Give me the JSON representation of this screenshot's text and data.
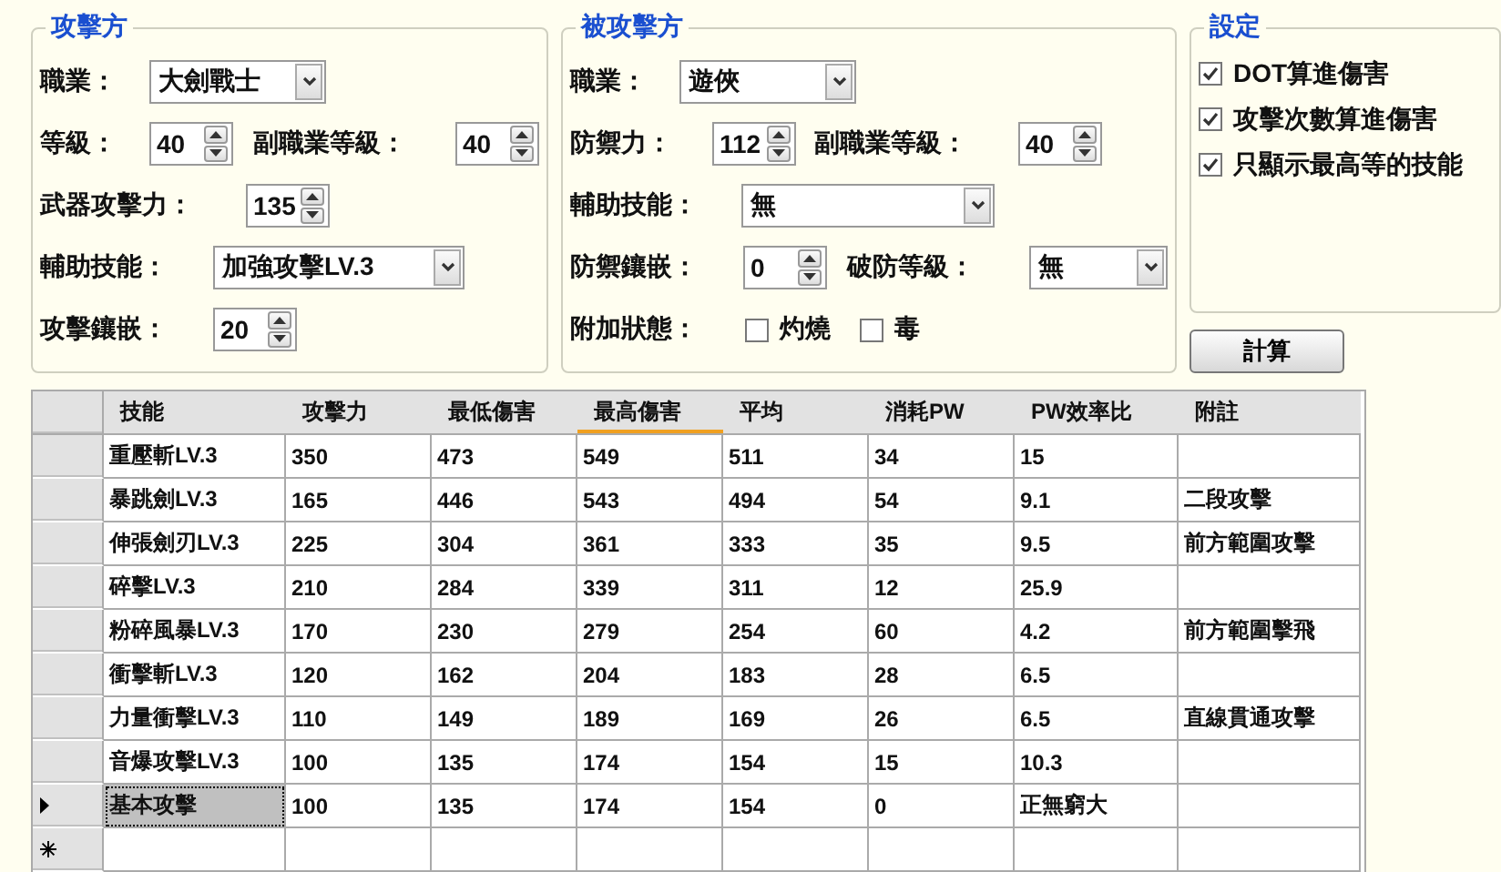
{
  "attacker": {
    "title": "攻擊方",
    "job": {
      "label": "職業：",
      "value": "大劍戰士"
    },
    "level": {
      "label": "等級：",
      "value": "40"
    },
    "sub_job_level": {
      "label": "副職業等級：",
      "value": "40"
    },
    "weapon_attack": {
      "label": "武器攻擊力：",
      "value": "135"
    },
    "support_skill": {
      "label": "輔助技能：",
      "value": "加強攻擊LV.3"
    },
    "attack_socket": {
      "label": "攻擊鑲嵌：",
      "value": "20"
    }
  },
  "defender": {
    "title": "被攻擊方",
    "job": {
      "label": "職業：",
      "value": "遊俠"
    },
    "defense": {
      "label": "防禦力：",
      "value": "112"
    },
    "sub_job_level": {
      "label": "副職業等級：",
      "value": "40"
    },
    "support_skill": {
      "label": "輔助技能：",
      "value": "無"
    },
    "defense_socket": {
      "label": "防禦鑲嵌：",
      "value": "0"
    },
    "break_level": {
      "label": "破防等級：",
      "value": "無"
    },
    "status": {
      "label": "附加狀態：",
      "options": [
        {
          "label": "灼燒",
          "checked": false
        },
        {
          "label": "毒",
          "checked": false
        }
      ]
    }
  },
  "settings": {
    "title": "設定",
    "options": [
      {
        "label": "DOT算進傷害",
        "checked": true
      },
      {
        "label": "攻擊次數算進傷害",
        "checked": true
      },
      {
        "label": "只顯示最高等的技能",
        "checked": true
      }
    ]
  },
  "calculate_button": "計算",
  "table": {
    "columns": [
      {
        "label": "技能",
        "sorted": false
      },
      {
        "label": "攻擊力",
        "sorted": false
      },
      {
        "label": "最低傷害",
        "sorted": false
      },
      {
        "label": "最高傷害",
        "sorted": true
      },
      {
        "label": "平均",
        "sorted": false
      },
      {
        "label": "消耗PW",
        "sorted": false
      },
      {
        "label": "PW效率比",
        "sorted": false
      },
      {
        "label": "附註",
        "sorted": false
      }
    ],
    "rows": [
      {
        "selected": false,
        "cells": [
          "重壓斬LV.3",
          "350",
          "473",
          "549",
          "511",
          "34",
          "15",
          ""
        ]
      },
      {
        "selected": false,
        "cells": [
          "暴跳劍LV.3",
          "165",
          "446",
          "543",
          "494",
          "54",
          "9.1",
          "二段攻擊"
        ]
      },
      {
        "selected": false,
        "cells": [
          "伸張劍刃LV.3",
          "225",
          "304",
          "361",
          "333",
          "35",
          "9.5",
          "前方範圍攻擊"
        ]
      },
      {
        "selected": false,
        "cells": [
          "碎擊LV.3",
          "210",
          "284",
          "339",
          "311",
          "12",
          "25.9",
          ""
        ]
      },
      {
        "selected": false,
        "cells": [
          "粉碎風暴LV.3",
          "170",
          "230",
          "279",
          "254",
          "60",
          "4.2",
          "前方範圍擊飛"
        ]
      },
      {
        "selected": false,
        "cells": [
          "衝擊斬LV.3",
          "120",
          "162",
          "204",
          "183",
          "28",
          "6.5",
          ""
        ]
      },
      {
        "selected": false,
        "cells": [
          "力量衝擊LV.3",
          "110",
          "149",
          "189",
          "169",
          "26",
          "6.5",
          "直線貫通攻擊"
        ]
      },
      {
        "selected": false,
        "cells": [
          "音爆攻擊LV.3",
          "100",
          "135",
          "174",
          "154",
          "15",
          "10.3",
          ""
        ]
      },
      {
        "selected": true,
        "cells": [
          "基本攻擊",
          "100",
          "135",
          "174",
          "154",
          "0",
          "正無窮大",
          ""
        ]
      }
    ]
  }
}
